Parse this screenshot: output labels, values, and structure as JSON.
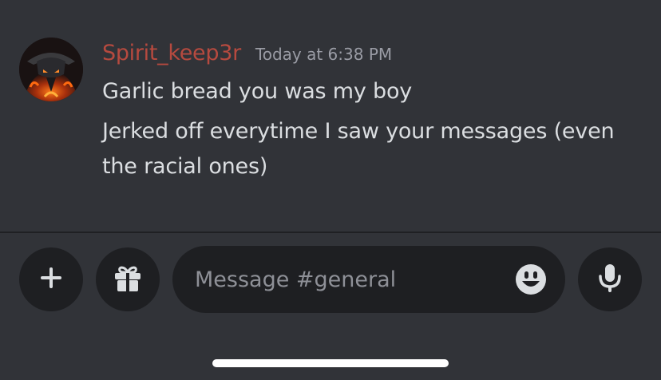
{
  "message": {
    "username": "Spirit_keep3r",
    "timestamp": "Today at 6:38 PM",
    "lines": [
      "Garlic bread you was my boy",
      "Jerked off everytime I saw your messages (even the racial ones)"
    ],
    "username_color": "#b64a3f"
  },
  "composer": {
    "placeholder": "Message #general",
    "add_icon": "plus-icon",
    "gift_icon": "gift-icon",
    "emoji_icon": "emoji-icon",
    "mic_icon": "microphone-icon"
  },
  "colors": {
    "background": "#313338",
    "input_background": "#1e1f22",
    "text": "#dbdee1",
    "muted": "#9a9ca5"
  }
}
